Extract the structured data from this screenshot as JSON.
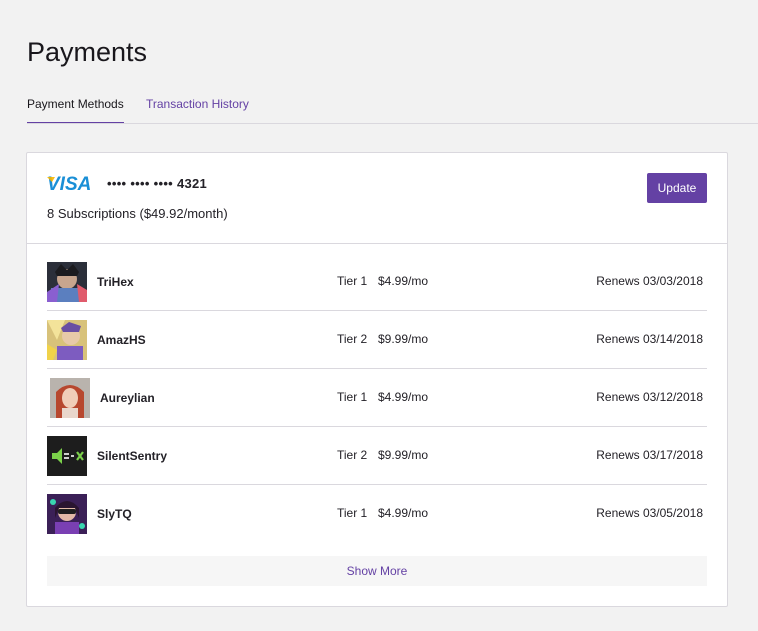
{
  "page": {
    "title": "Payments"
  },
  "tabs": [
    {
      "label": "Payment Methods",
      "active": true
    },
    {
      "label": "Transaction History",
      "active": false
    }
  ],
  "payment_card": {
    "brand": "VISA",
    "masked_number": "•••• •••• •••• 4321",
    "subscriptions_summary": "8 Subscriptions ($49.92/month)",
    "update_label": "Update"
  },
  "subscriptions": [
    {
      "channel": "TriHex",
      "tier": "Tier 1",
      "price": "$4.99/mo",
      "renews": "Renews 03/03/2018",
      "avatar_icon": "trihex-avatar"
    },
    {
      "channel": "AmazHS",
      "tier": "Tier 2",
      "price": "$9.99/mo",
      "renews": "Renews 03/14/2018",
      "avatar_icon": "amazhs-avatar"
    },
    {
      "channel": "Aureylian",
      "tier": "Tier 1",
      "price": "$4.99/mo",
      "renews": "Renews 03/12/2018",
      "avatar_icon": "aureylian-avatar"
    },
    {
      "channel": "SilentSentry",
      "tier": "Tier 2",
      "price": "$9.99/mo",
      "renews": "Renews 03/17/2018",
      "avatar_icon": "silentsentry-avatar"
    },
    {
      "channel": "SlyTQ",
      "tier": "Tier 1",
      "price": "$4.99/mo",
      "renews": "Renews 03/05/2018",
      "avatar_icon": "slytq-avatar"
    }
  ],
  "show_more_label": "Show More",
  "colors": {
    "accent": "#6441a4",
    "background": "#f2f2f2",
    "card": "#ffffff",
    "border": "#dad8de",
    "visa_blue": "#1a8fd6",
    "visa_gold": "#f7b600"
  }
}
